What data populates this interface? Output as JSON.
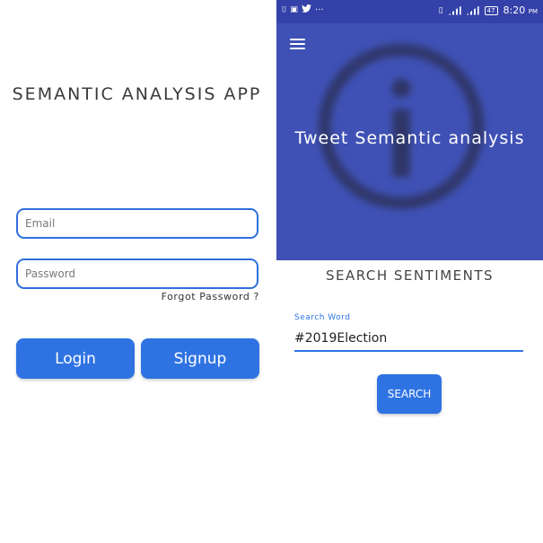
{
  "colors": {
    "accent": "#2f73e3",
    "header": "#3f51b5",
    "statusbar": "#3441a8"
  },
  "login": {
    "title": "SEMANTIC ANALYSIS APP",
    "email_placeholder": "Email",
    "password_placeholder": "Password",
    "forgot_label": "Forgot Password ?",
    "login_label": "Login",
    "signup_label": "Signup"
  },
  "status_bar": {
    "time": "8:20",
    "ampm": "PM",
    "battery": "47",
    "icons": [
      "notification-icon",
      "image-icon",
      "twitter-icon",
      "more-icon",
      "vibrate-icon",
      "signal-icon",
      "signal-icon",
      "battery-icon"
    ]
  },
  "app": {
    "header_title": "Tweet Semantic analysis",
    "section_title": "SEARCH SENTIMENTS",
    "search_label": "Search Word",
    "search_value": "#2019Election",
    "search_button": "SEARCH"
  }
}
